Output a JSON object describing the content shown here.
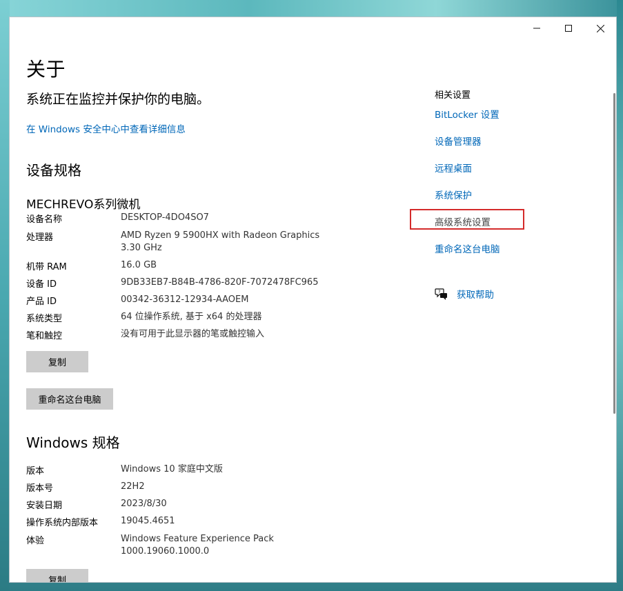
{
  "window": {
    "controls": {
      "minimize": "minimize-icon",
      "maximize": "maximize-icon",
      "close": "close-icon"
    }
  },
  "page": {
    "title": "关于",
    "status": "系统正在监控并保护你的电脑。",
    "security_link": "在 Windows 安全中心中查看详细信息"
  },
  "device_spec": {
    "section_title": "设备规格",
    "device_name": "MECHREVO系列微机",
    "rows": [
      {
        "key": "设备名称",
        "value": "DESKTOP-4DO4SO7"
      },
      {
        "key": "处理器",
        "value": "AMD Ryzen 9 5900HX with Radeon Graphics\n3.30 GHz"
      },
      {
        "key": "机带 RAM",
        "value": "16.0 GB"
      },
      {
        "key": "设备 ID",
        "value": "9DB33EB7-B84B-4786-820F-7072478FC965"
      },
      {
        "key": "产品 ID",
        "value": "00342-36312-12934-AAOEM"
      },
      {
        "key": "系统类型",
        "value": "64 位操作系统, 基于 x64 的处理器"
      },
      {
        "key": "笔和触控",
        "value": "没有可用于此显示器的笔或触控输入"
      }
    ],
    "copy_button": "复制",
    "rename_button": "重命名这台电脑"
  },
  "windows_spec": {
    "section_title": "Windows 规格",
    "rows": [
      {
        "key": "版本",
        "value": "Windows 10 家庭中文版"
      },
      {
        "key": "版本号",
        "value": "22H2"
      },
      {
        "key": "安装日期",
        "value": "2023/8/30"
      },
      {
        "key": "操作系统内部版本",
        "value": "19045.4651"
      },
      {
        "key": "体验",
        "value": "Windows Feature Experience Pack\n1000.19060.1000.0"
      }
    ],
    "copy_button": "复制"
  },
  "related": {
    "title": "相关设置",
    "links": [
      "BitLocker 设置",
      "设备管理器",
      "远程桌面",
      "系统保护",
      "高级系统设置",
      "重命名这台电脑"
    ],
    "help": "获取帮助",
    "highlight_color": "#d42a2a",
    "link_color": "#0067b8"
  }
}
